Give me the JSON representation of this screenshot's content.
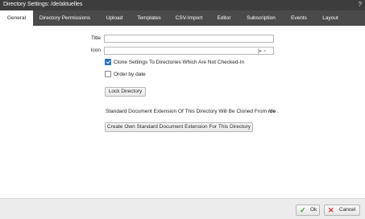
{
  "dialog": {
    "title": "Directory Settings: /de/aktuelles",
    "help_label": "?"
  },
  "tabs": [
    {
      "label": "General",
      "active": true
    },
    {
      "label": "Directory Permissions",
      "active": false
    },
    {
      "label": "Upload",
      "active": false
    },
    {
      "label": "Templates",
      "active": false
    },
    {
      "label": "CSV-Import",
      "active": false
    },
    {
      "label": "Editor",
      "active": false
    },
    {
      "label": "Subscription",
      "active": false
    },
    {
      "label": "Events",
      "active": false
    },
    {
      "label": "Layout",
      "active": false
    }
  ],
  "form": {
    "title_label": "Title",
    "title_value": "",
    "icon_label": "Icon",
    "icon_value": "",
    "icon_tools": "[▸ ⌕",
    "clone_settings": {
      "label": "Clone Settings To Directories Which Are Not Checked-In",
      "checked": true
    },
    "order_by_date": {
      "label": "Order by date",
      "checked": false
    },
    "lock_directory_label": "Lock Directory",
    "extension_info_prefix": "Standard Document Extension Of This Directory Will Be Cloned From",
    "extension_info_path": "/de",
    "extension_info_suffix": ".",
    "create_extension_label": "Create Own Standard Document Extension For This Directory"
  },
  "footer": {
    "ok_label": "Ok",
    "cancel_label": "Cancel"
  },
  "colors": {
    "titlebar": "#3d3d3d",
    "tabbar": "#4a4a4a",
    "checkbox_checked": "#2a6fc9",
    "ok_icon": "#2e9e2e",
    "cancel_icon": "#d12c2c"
  }
}
